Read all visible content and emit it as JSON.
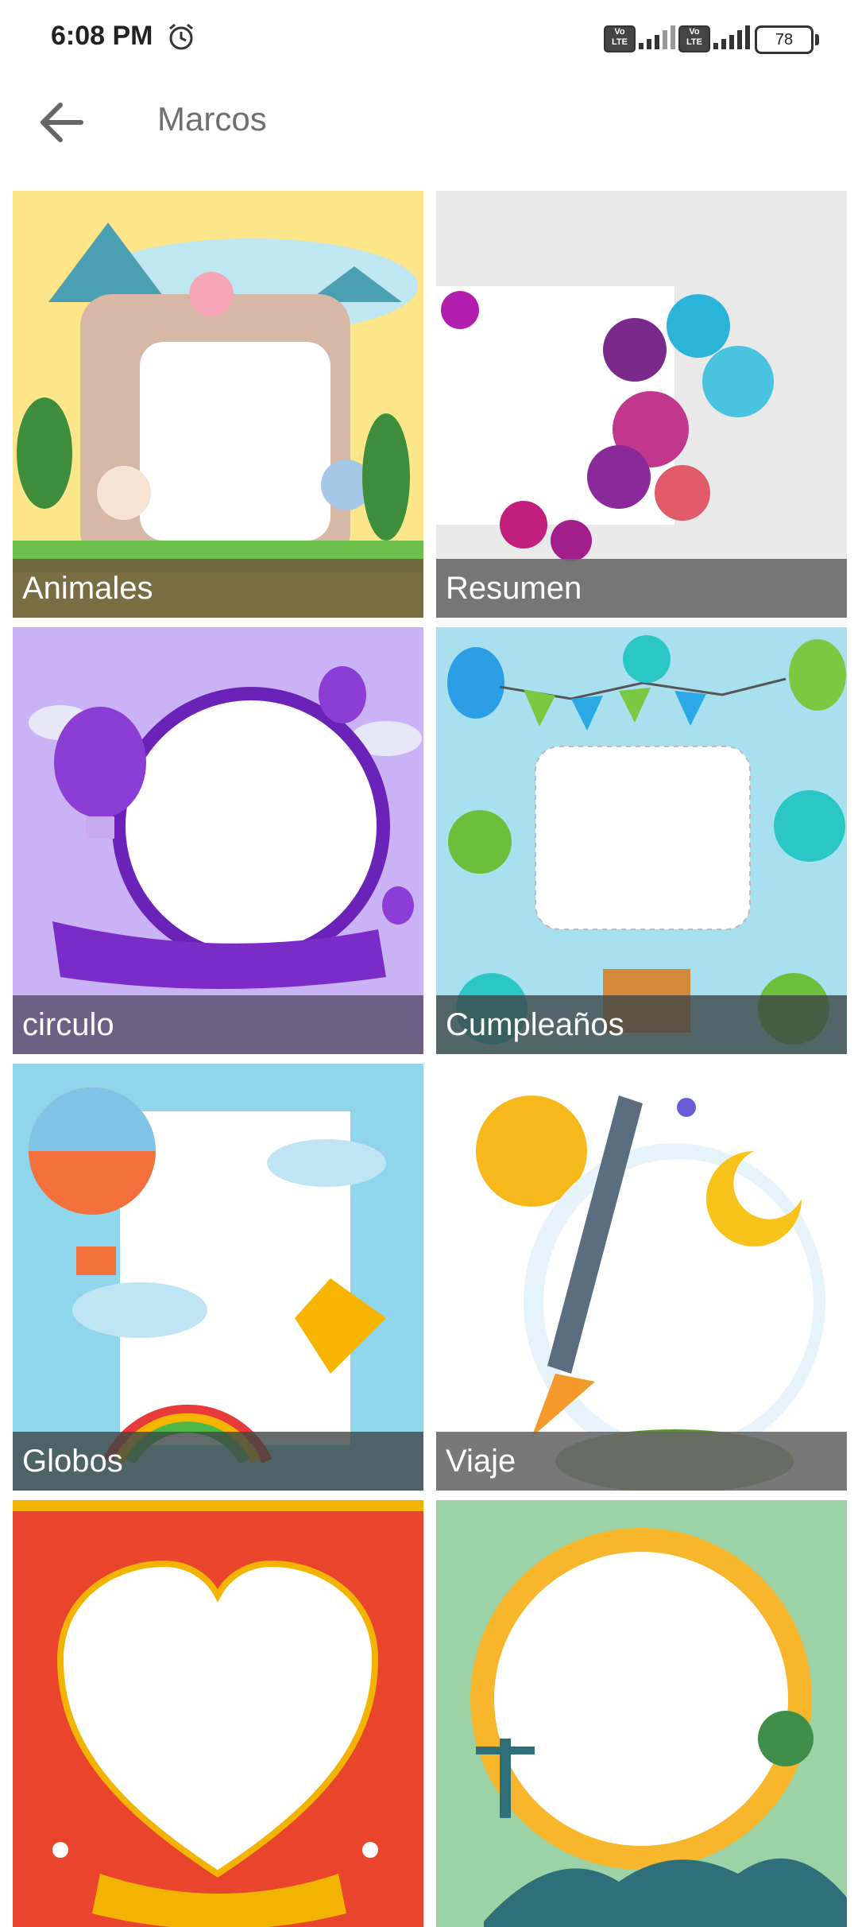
{
  "status_bar": {
    "time": "6:08 PM",
    "volte1": "Vo LTE",
    "volte2": "Vo LTE",
    "battery": "78",
    "icons": [
      "alarm-icon",
      "volte-icon",
      "signal-icon",
      "volte-icon",
      "signal-icon",
      "battery-icon"
    ]
  },
  "appbar": {
    "back_icon": "arrow-left-icon",
    "title": "Marcos"
  },
  "frames": [
    {
      "label": "Animales"
    },
    {
      "label": "Resumen"
    },
    {
      "label": "circulo"
    },
    {
      "label": "Cumpleaños"
    },
    {
      "label": "Globos"
    },
    {
      "label": "Viaje"
    },
    {
      "label": ""
    },
    {
      "label": ""
    }
  ],
  "colors": {
    "animales_bg": "#fde68a",
    "resumen_bg": "#e9e9e9",
    "circulo_bg": "#c9b2f5",
    "cumpleanos_bg": "#a8e0f0",
    "globos_bg": "#8fd6ec",
    "viaje_bg": "#ffffff",
    "corazon_bg": "#e8452c",
    "sol_bg": "#9bd3a6"
  }
}
